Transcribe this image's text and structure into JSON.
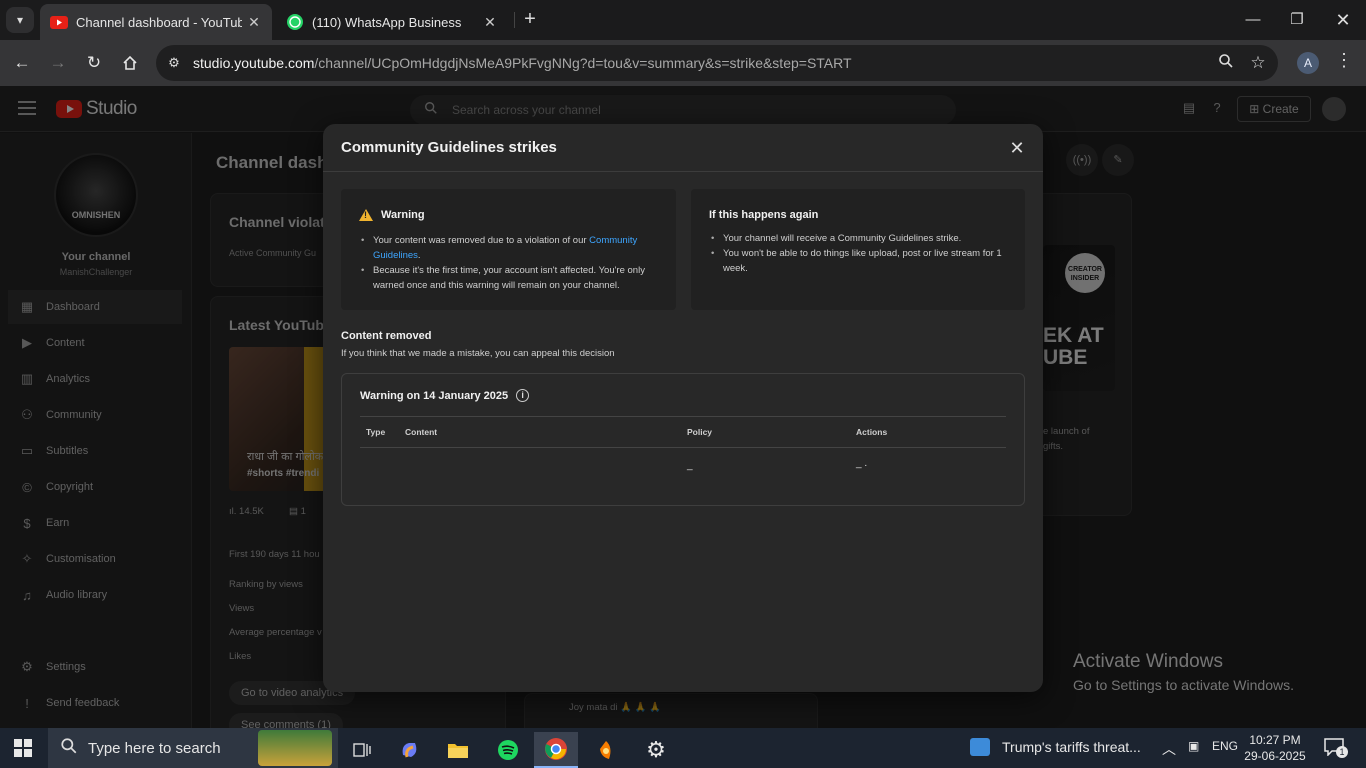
{
  "browser": {
    "tabs": [
      {
        "title": "Channel dashboard - YouTube S",
        "active": true
      },
      {
        "title": "(110) WhatsApp Business",
        "active": false
      }
    ],
    "url_host": "studio.youtube.com",
    "url_path": "/channel/UCpOmHdgdjNsMeA9PkFvgNNg?d=tou&v=summary&s=strike&step=START",
    "profile_initial": "A"
  },
  "studio": {
    "logo_text": "Studio",
    "search_placeholder": "Search across your channel",
    "create_label": "Create",
    "sidebar": {
      "avatar_text": "OMNISHEN",
      "your_channel": "Your channel",
      "handle": "ManishChallenger",
      "items": [
        {
          "label": "Dashboard",
          "icon": "dashboard-icon"
        },
        {
          "label": "Content",
          "icon": "content-icon"
        },
        {
          "label": "Analytics",
          "icon": "analytics-icon"
        },
        {
          "label": "Community",
          "icon": "community-icon"
        },
        {
          "label": "Subtitles",
          "icon": "subtitles-icon"
        },
        {
          "label": "Copyright",
          "icon": "copyright-icon"
        },
        {
          "label": "Earn",
          "icon": "earn-icon"
        },
        {
          "label": "Customisation",
          "icon": "customisation-icon"
        },
        {
          "label": "Audio library",
          "icon": "audio-library-icon"
        },
        {
          "label": "Settings",
          "icon": "gear-icon"
        },
        {
          "label": "Send feedback",
          "icon": "feedback-icon"
        }
      ]
    },
    "page_title": "Channel dash",
    "violations_card": {
      "title": "Channel violatio",
      "sub": "Active Community Gu"
    },
    "latest_card": {
      "title": "Latest YouTube",
      "video_caption": "राधा जी का गोलोक",
      "video_tags": "#shorts #trendi",
      "views": "14.5K",
      "comments": "1",
      "period": "First 190 days 11 hou",
      "rows": [
        "Ranking by views",
        "Views",
        "Average percentage v",
        "Likes"
      ],
      "analytics_btn": "Go to video analytics",
      "comments_btn": "See comments (1)"
    },
    "news_card": {
      "creator_badge": "CREATOR INSIDER",
      "thumb_text": "EK AT UBE",
      "text1": "e launch of",
      "text2": "gifts."
    },
    "comment_snippet": "Joy mata di 🙏 🙏 🙏"
  },
  "dialog": {
    "title": "Community Guidelines strikes",
    "warning_box": {
      "heading": "Warning",
      "bullet1_pre": "Your content was removed due to a violation of our ",
      "bullet1_link": "Community Guidelines",
      "bullet1_post": ".",
      "bullet2": "Because it's the first time, your account isn't affected. You're only warned once and this warning will remain on your channel."
    },
    "again_box": {
      "heading": "If this happens again",
      "bullet1": "Your channel will receive a Community Guidelines strike.",
      "bullet2": "You won't be able to do things like upload, post or live stream for 1 week."
    },
    "content_removed": "Content removed",
    "appeal_text": "If you think that we made a mistake, you can appeal this decision",
    "warning_date": "Warning on 14 January 2025",
    "table_headers": {
      "type": "Type",
      "content": "Content",
      "policy": "Policy",
      "actions": "Actions"
    },
    "row": {
      "policy": "_",
      "actions": "_ ."
    }
  },
  "watermark": {
    "line1": "Activate Windows",
    "line2": "Go to Settings to activate Windows."
  },
  "taskbar": {
    "search_text": "Type here to search",
    "news": "Trump's tariffs threat...",
    "lang": "ENG",
    "time": "10:27 PM",
    "date": "29-06-2025",
    "notif_count": "1"
  }
}
